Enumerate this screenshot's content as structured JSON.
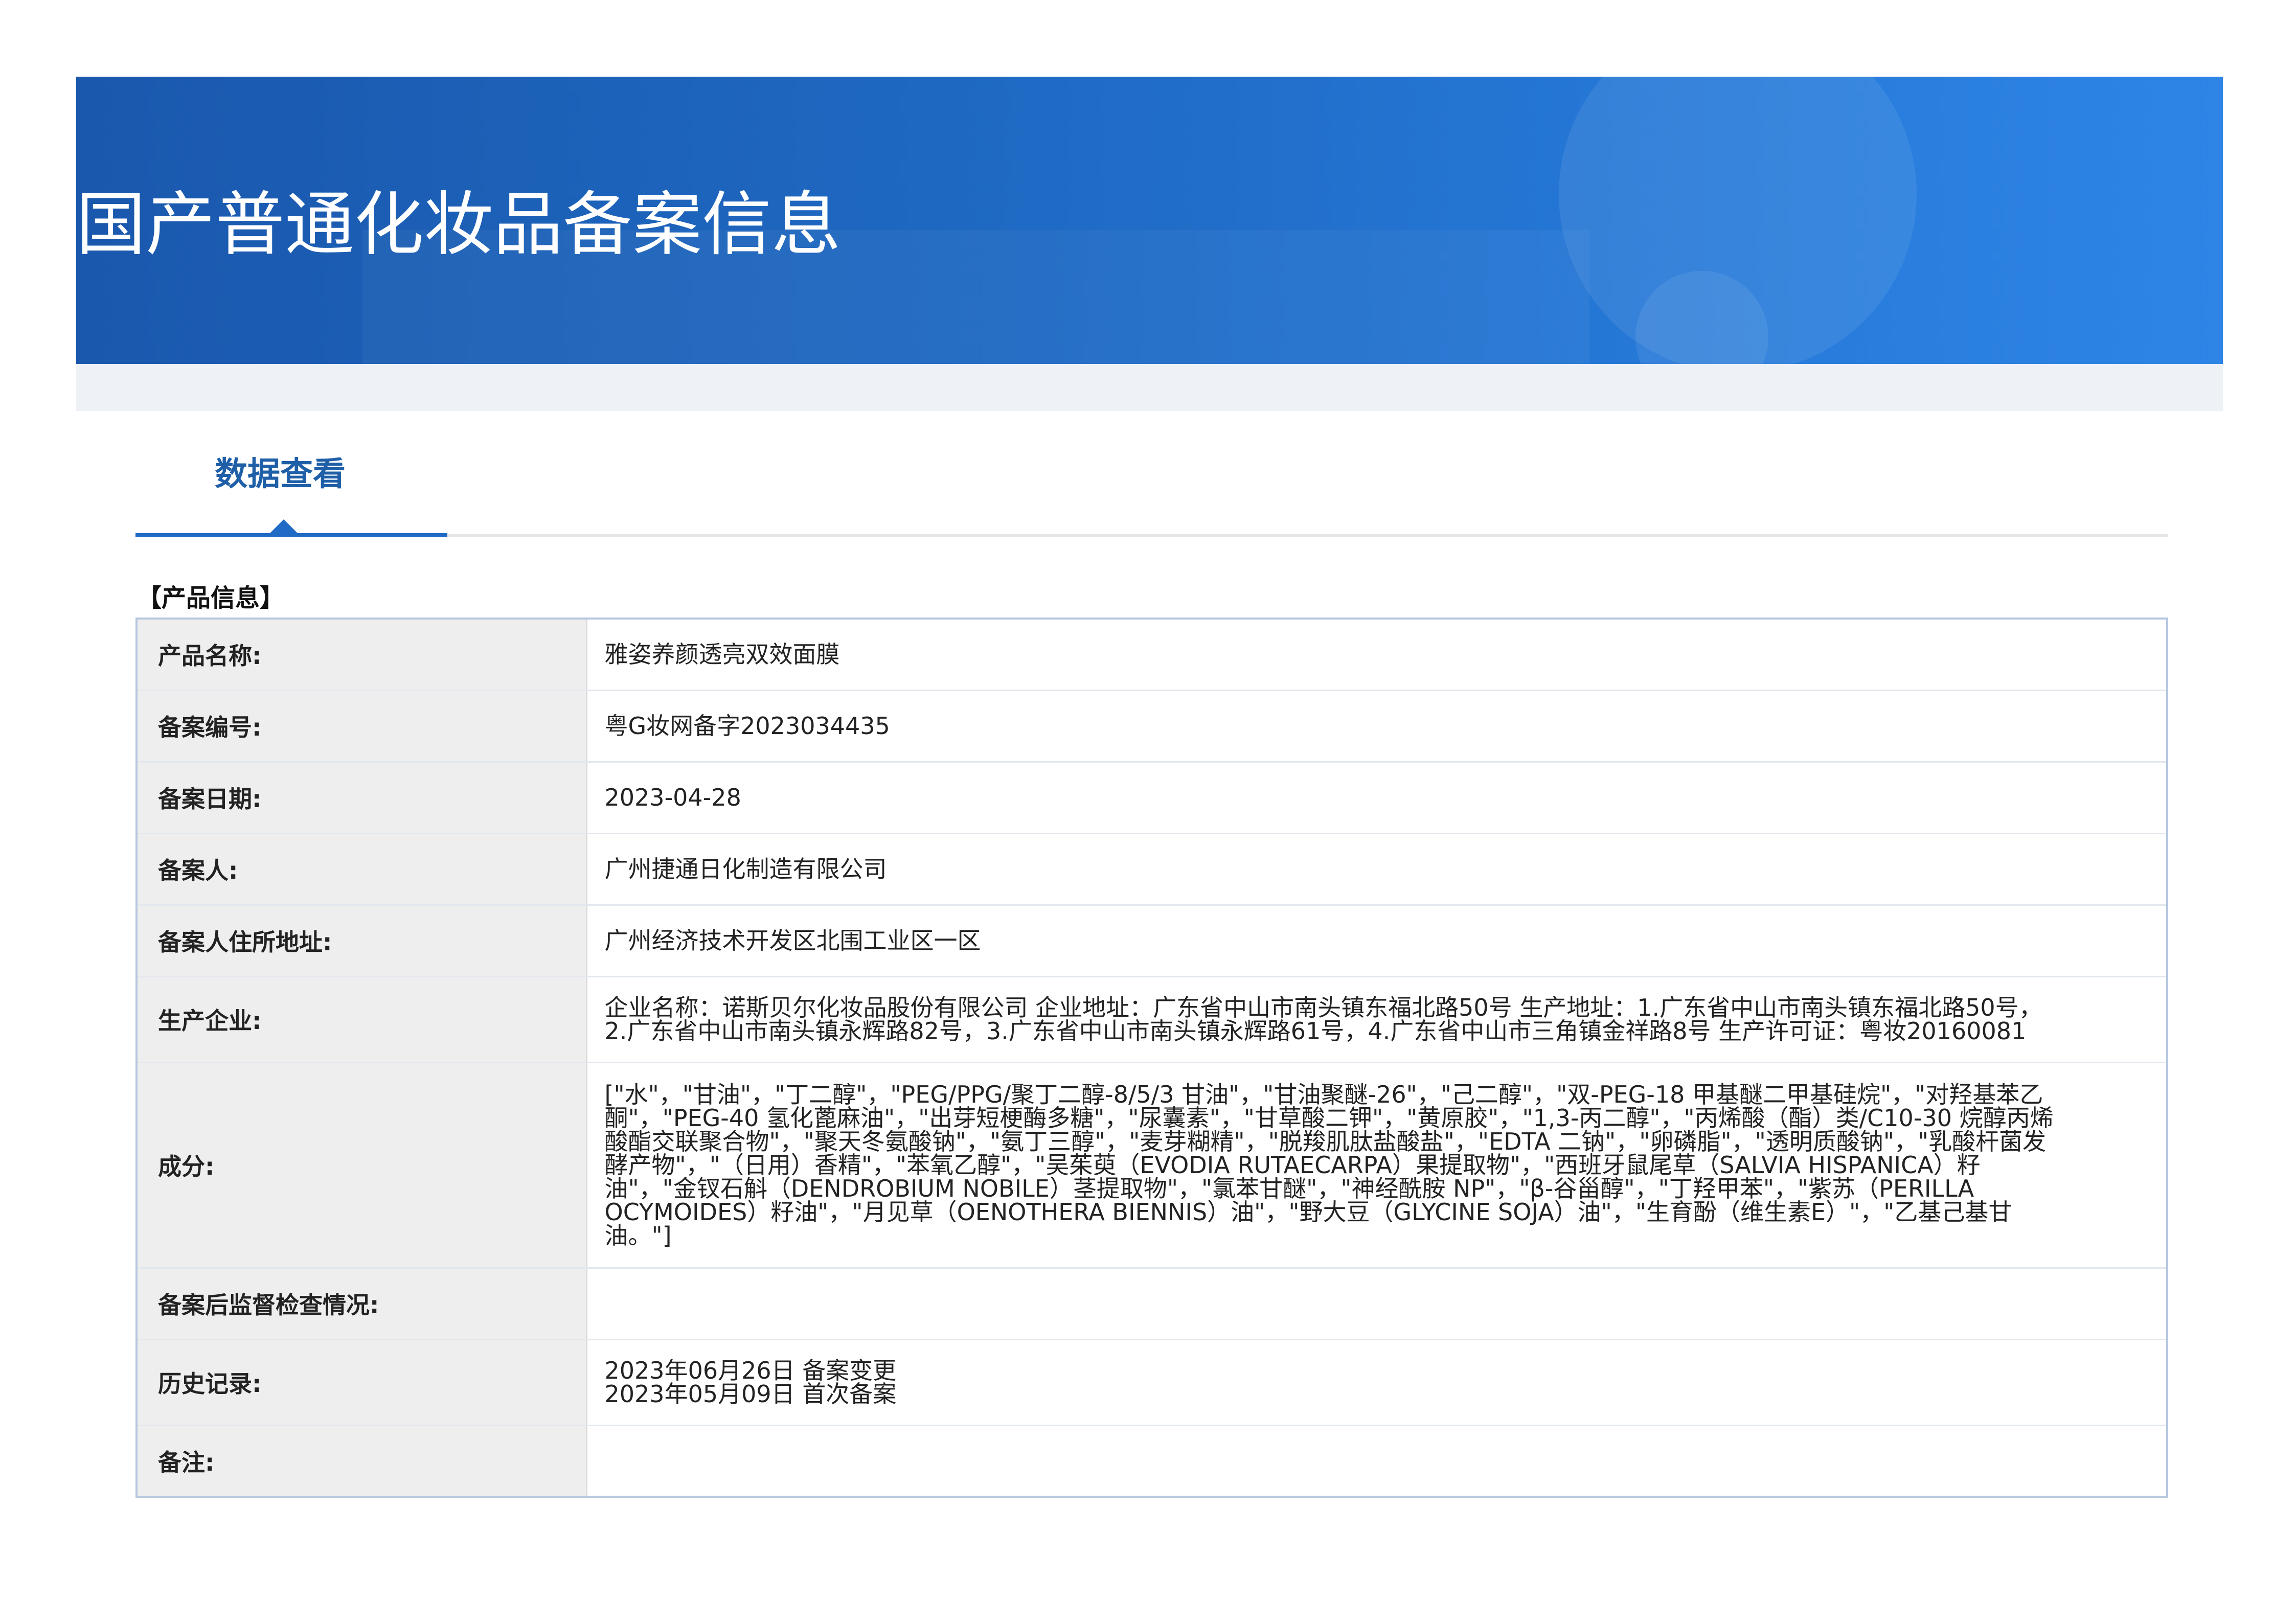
{
  "banner": {
    "title": "国产普通化妆品备案信息"
  },
  "tab": {
    "label": "数据查看"
  },
  "section": {
    "title": "【产品信息】"
  },
  "rows": [
    {
      "label": "产品名称:",
      "value": "雅姿养颜透亮双效面膜"
    },
    {
      "label": "备案编号:",
      "value": "粤G妆网备字2023034435"
    },
    {
      "label": "备案日期:",
      "value": "2023-04-28"
    },
    {
      "label": "备案人:",
      "value": "广州捷通日化制造有限公司"
    },
    {
      "label": "备案人住所地址:",
      "value": "广州经济技术开发区北围工业区一区"
    },
    {
      "label": "生产企业:",
      "value": "企业名称：诺斯贝尔化妆品股份有限公司 企业地址：广东省中山市南头镇东福北路50号 生产地址：1.广东省中山市南头镇东福北路50号，2.广东省中山市南头镇永辉路82号，3.广东省中山市南头镇永辉路61号，4.广东省中山市三角镇金祥路8号 生产许可证：粤妆20160081"
    },
    {
      "label": "成分:",
      "value": "[\"水\"，\"甘油\"，\"丁二醇\"，\"PEG/PPG/聚丁二醇-8/5/3 甘油\"，\"甘油聚醚-26\"，\"己二醇\"，\"双-PEG-18 甲基醚二甲基硅烷\"，\"对羟基苯乙酮\"，\"PEG-40 氢化蓖麻油\"，\"出芽短梗酶多糖\"，\"尿囊素\"，\"甘草酸二钾\"，\"黄原胶\"，\"1,3-丙二醇\"，\"丙烯酸（酯）类/C10-30 烷醇丙烯酸酯交联聚合物\"，\"聚天冬氨酸钠\"，\"氨丁三醇\"，\"麦芽糊精\"，\"脱羧肌肽盐酸盐\"，\"EDTA 二钠\"，\"卵磷脂\"，\"透明质酸钠\"，\"乳酸杆菌发酵产物\"，\"（日用）香精\"，\"苯氧乙醇\"，\"吴茱萸（EVODIA RUTAECARPA）果提取物\"，\"西班牙鼠尾草（SALVIA HISPANICA）籽油\"，\"金钗石斛（DENDROBIUM NOBILE）茎提取物\"，\"氯苯甘醚\"，\"神经酰胺 NP\"，\"β-谷甾醇\"，\"丁羟甲苯\"，\"紫苏（PERILLA OCYMOIDES）籽油\"，\"月见草（OENOTHERA BIENNIS）油\"，\"野大豆（GLYCINE SOJA）油\"，\"生育酚（维生素E）\"，\"乙基己基甘油。\"]"
    },
    {
      "label": "备案后监督检查情况:",
      "value": ""
    },
    {
      "label": "历史记录:",
      "lines": [
        "2023年06月26日 备案变更",
        "2023年05月09日 首次备案"
      ]
    },
    {
      "label": "备注:",
      "value": ""
    }
  ]
}
